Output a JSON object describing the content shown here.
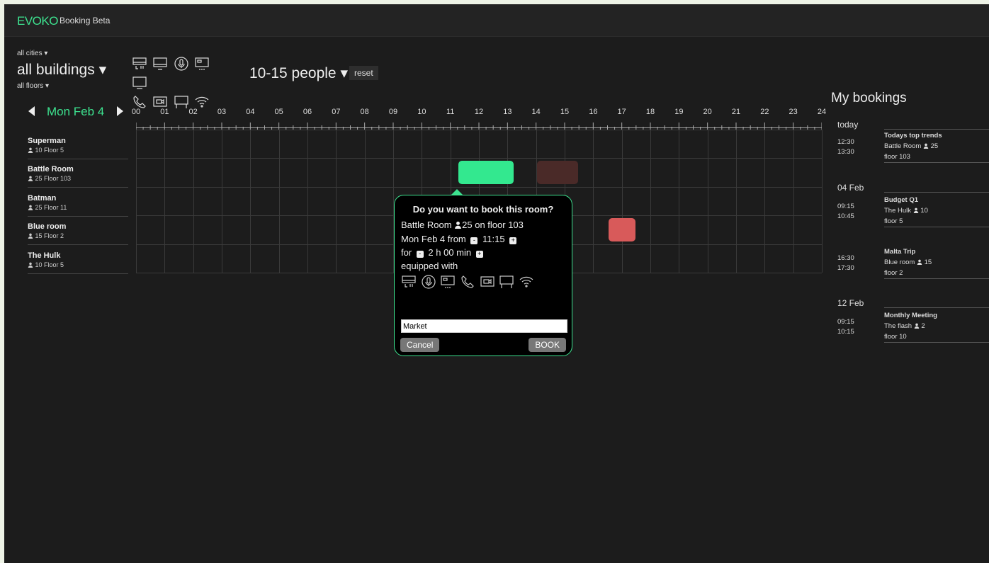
{
  "app": {
    "brand": "EVOKO",
    "subtitle": "Booking Beta"
  },
  "filters": {
    "city": "all cities ▾",
    "building": "all buildings ▾",
    "floors": "all floors ▾",
    "people": "10-15 people ▾",
    "reset": "reset"
  },
  "amenity_icons": [
    "projector-icon",
    "monitor-icon",
    "microphone-icon",
    "screen-icon",
    "display-icon",
    "phone-icon",
    "video-icon",
    "whiteboard-icon",
    "wifi-icon"
  ],
  "date_nav": {
    "label": "Mon Feb 4"
  },
  "hours": [
    "00",
    "01",
    "02",
    "03",
    "04",
    "05",
    "06",
    "07",
    "08",
    "09",
    "10",
    "11",
    "12",
    "13",
    "14",
    "15",
    "16",
    "17",
    "18",
    "19",
    "20",
    "21",
    "22",
    "23",
    "24"
  ],
  "rooms": [
    {
      "name": "Superman",
      "info": "10 Floor 5"
    },
    {
      "name": "Battle Room",
      "info": "25 Floor 103"
    },
    {
      "name": "Batman",
      "info": "25 Floor 11"
    },
    {
      "name": "Blue room",
      "info": "15 Floor 2"
    },
    {
      "name": "The Hulk",
      "info": "10 Floor 5"
    }
  ],
  "bookings": [
    {
      "room": 1,
      "start": 11.25,
      "end": 13.25,
      "status": "selected",
      "color": "#33e88f"
    },
    {
      "room": 1,
      "start": 14.0,
      "end": 15.5,
      "status": "booked",
      "color": "#4a2a28"
    },
    {
      "room": 3,
      "start": 16.5,
      "end": 17.5,
      "status": "conflict",
      "color": "#d85a5a"
    }
  ],
  "dialog": {
    "title": "Do you want to book this room?",
    "room_line_a": "Battle Room ",
    "room_line_b": "25 on floor 103",
    "date_line_a": "Mon Feb 4 from",
    "time": "11:15",
    "for_label": "for",
    "duration": "2 h 00 min",
    "equipped": "equipped with",
    "input_value": "Market",
    "cancel": "Cancel",
    "book": "BOOK",
    "minus": "-",
    "plus": "+"
  },
  "my_bookings": {
    "title": "My bookings",
    "groups": [
      {
        "day": "today",
        "items": [
          {
            "start": "12:30",
            "end": "13:30",
            "title": "Todays top trends",
            "room": "Battle Room",
            "cap": "25",
            "floor": "floor 103"
          }
        ]
      },
      {
        "day": "04 Feb",
        "items": [
          {
            "start": "09:15",
            "end": "10:45",
            "title": "Budget Q1",
            "room": "The Hulk",
            "cap": "10",
            "floor": "floor 5"
          },
          {
            "start": "16:30",
            "end": "17:30",
            "title": "Malta Trip",
            "room": "Blue room",
            "cap": "15",
            "floor": "floor 2"
          }
        ]
      },
      {
        "day": "12 Feb",
        "items": [
          {
            "start": "09:15",
            "end": "10:15",
            "title": "Monthly Meeting",
            "room": "The flash",
            "cap": "2",
            "floor": "floor 10"
          }
        ]
      }
    ]
  }
}
